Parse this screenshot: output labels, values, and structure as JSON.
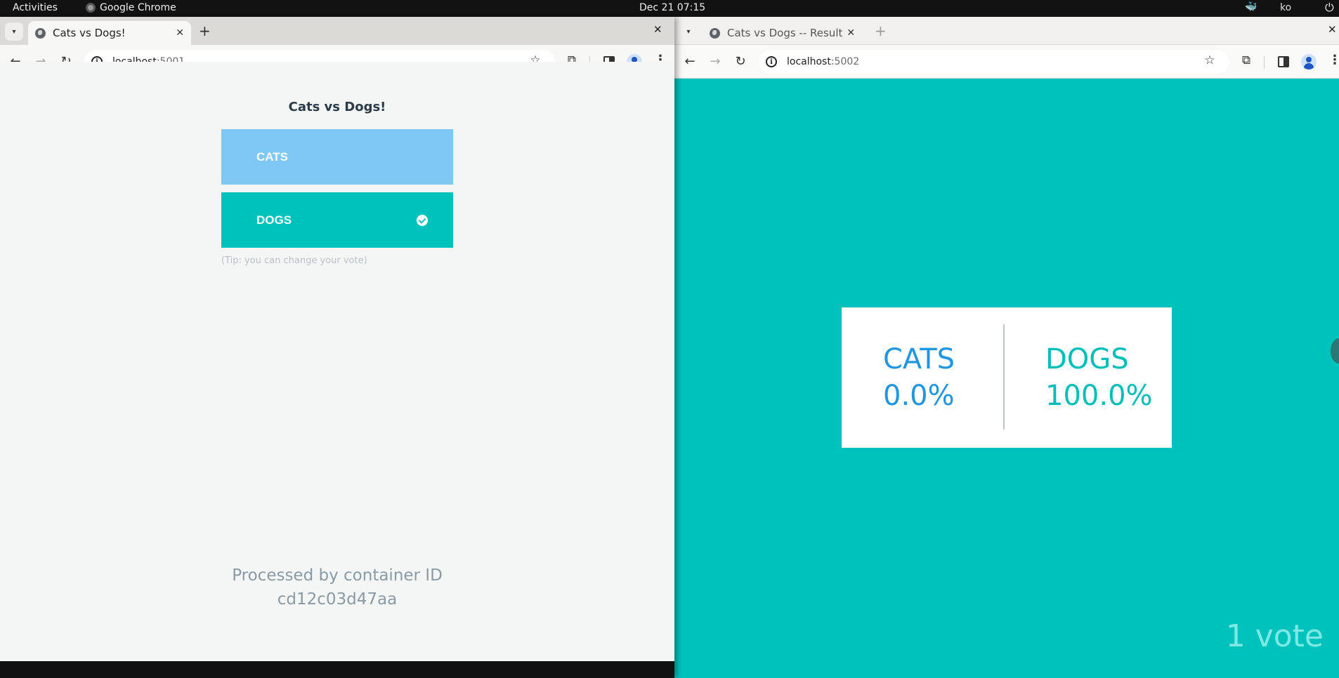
{
  "system_bar": {
    "activities": "Activities",
    "app_name": "Google Chrome",
    "clock": "Dec 21  07:15",
    "user": "ko",
    "icons": [
      "docker-icon",
      "power-icon"
    ]
  },
  "vote_window": {
    "tab_title": "Cats vs Dogs!",
    "url_host": "localhost",
    "url_port": ":5001",
    "page": {
      "title": "Cats vs Dogs!",
      "options": [
        {
          "label": "CATS",
          "selected": false,
          "color": "#7fc8f5"
        },
        {
          "label": "DOGS",
          "selected": true,
          "color": "#00c2bd"
        }
      ],
      "tip": "(Tip: you can change your vote)",
      "container_line1": "Processed by container ID",
      "container_id": "cd12c03d47aa"
    }
  },
  "result_window": {
    "tab_title": "Cats vs Dogs -- Result",
    "url_host": "localhost",
    "url_port": ":5002",
    "page": {
      "background": "#00c2bd",
      "results": [
        {
          "label": "CATS",
          "percent": "0.0%",
          "color": "#2196e0"
        },
        {
          "label": "DOGS",
          "percent": "100.0%",
          "color": "#00bfba"
        }
      ],
      "vote_count": "1 vote"
    }
  }
}
